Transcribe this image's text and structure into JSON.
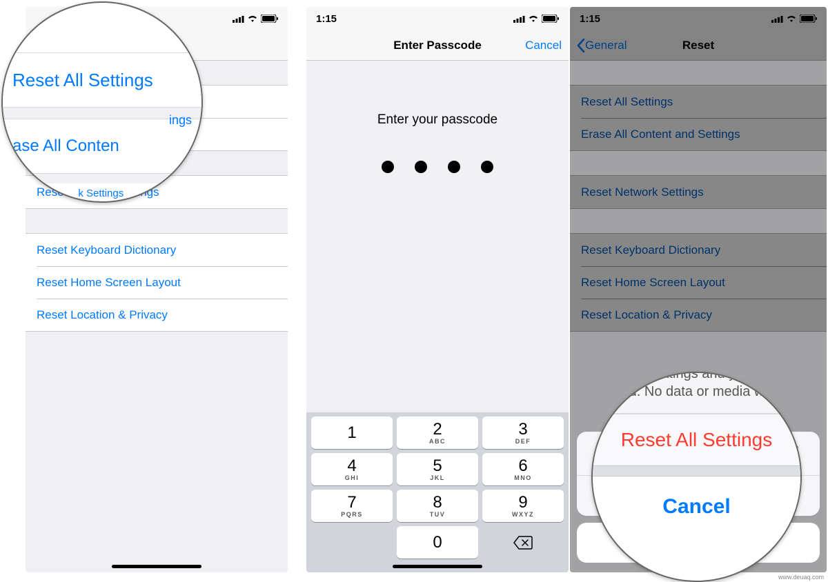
{
  "status": {
    "time": "1:15"
  },
  "screen1": {
    "title": "Reset",
    "back": "General",
    "reset_all": "Reset All Settings",
    "erase_all": "Erase All Content and Settings",
    "reset_network": "Reset Network Settings",
    "reset_keyboard": "Reset Keyboard Dictionary",
    "reset_home": "Reset Home Screen Layout",
    "reset_location": "Reset Location & Privacy"
  },
  "screen2": {
    "title": "Enter Passcode",
    "cancel": "Cancel",
    "prompt": "Enter your passcode",
    "keys": {
      "k1": {
        "n": "1",
        "l": ""
      },
      "k2": {
        "n": "2",
        "l": "ABC"
      },
      "k3": {
        "n": "3",
        "l": "DEF"
      },
      "k4": {
        "n": "4",
        "l": "GHI"
      },
      "k5": {
        "n": "5",
        "l": "JKL"
      },
      "k6": {
        "n": "6",
        "l": "MNO"
      },
      "k7": {
        "n": "7",
        "l": "PQRS"
      },
      "k8": {
        "n": "8",
        "l": "TUV"
      },
      "k9": {
        "n": "9",
        "l": "WXYZ"
      },
      "k0": {
        "n": "0",
        "l": ""
      }
    }
  },
  "screen3": {
    "title": "Reset",
    "back": "General",
    "sheet_msg": "This will reset all settings. No data or media will be deleted.",
    "sheet_action": "Reset All Settings",
    "sheet_cancel": "Cancel"
  },
  "magnifier1": {
    "reset_all": "Reset All Settings",
    "erase_all_partial": "ase All Conten",
    "network_partial": "Res                k Settings",
    "erase_trailing": "ings"
  },
  "magnifier2": {
    "msg_partial_1": "ettings and y",
    "msg_partial_2": "d. No data or media w",
    "action": "Reset All Settings",
    "cancel": "Cancel"
  },
  "watermark": "www.deuaq.com"
}
